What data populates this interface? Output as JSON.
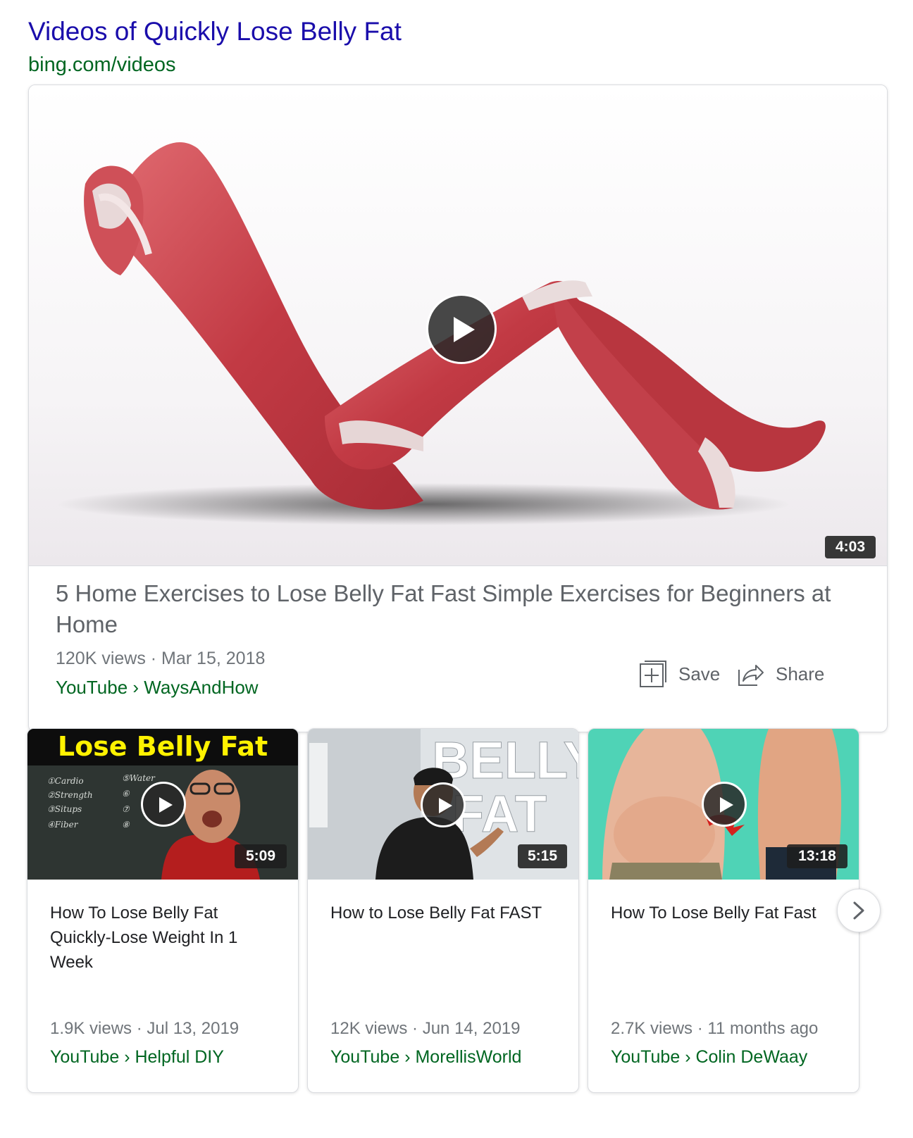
{
  "header": {
    "title": "Videos of Quickly Lose Belly Fat",
    "url": "bing.com/videos"
  },
  "featured": {
    "duration": "4:03",
    "title": "5 Home Exercises to Lose Belly Fat Fast Simple Exercises for Beginners at Home",
    "meta": "120K views · Mar 15, 2018",
    "source": "YouTube › WaysAndHow",
    "save_label": "Save",
    "share_label": "Share",
    "icons": {
      "play": "play-icon",
      "save": "add-to-collection-icon",
      "share": "share-arrow-icon"
    }
  },
  "videos": [
    {
      "thumb_text": "Lose Belly Fat",
      "board_notes": [
        "①Cardio",
        "②Strength",
        "③Situps",
        "④Fiber",
        "⑤Water",
        "⑥",
        "⑦",
        "⑧"
      ],
      "duration": "5:09",
      "title": "How To Lose Belly Fat Quickly-Lose Weight In 1 Week",
      "meta": "1.9K views · Jul 13, 2019",
      "source": "YouTube › Helpful DIY"
    },
    {
      "thumb_text_1": "BELLY",
      "thumb_text_2": "FAT",
      "duration": "5:15",
      "title": "How to Lose Belly Fat FAST",
      "meta": "12K views · Jun 14, 2019",
      "source": "YouTube › MorellisWorld"
    },
    {
      "duration": "13:18",
      "title": "How To Lose Belly Fat Fast",
      "meta": "2.7K views · 11 months ago",
      "source": "YouTube › Colin DeWaay"
    }
  ],
  "carousel": {
    "next_icon": "chevron-right-icon"
  },
  "colors": {
    "title_link": "#1a0dab",
    "url_green": "#006621",
    "muscle_red": "#c9444c",
    "thumb_yellow": "#fff200",
    "chalkboard": "#2e3532",
    "teal_bg": "#4fd3b6"
  }
}
